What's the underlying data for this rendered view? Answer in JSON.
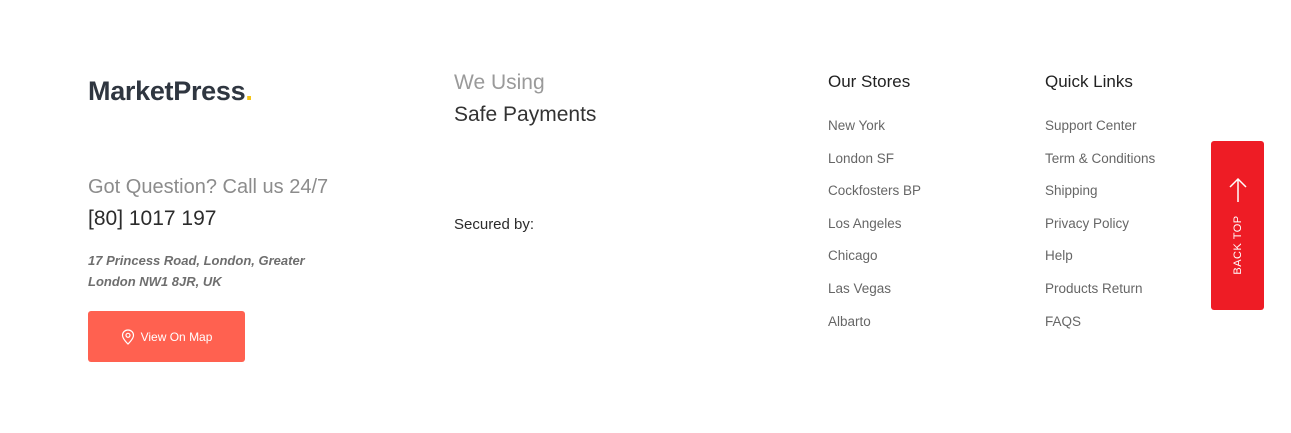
{
  "brand": {
    "name": "MarketPress",
    "dot": ".",
    "accent_color": "#f5c518"
  },
  "contact": {
    "question": "Got Question? Call us 24/7",
    "phone": "[80] 1017 197",
    "address_line1": "17 Princess Road, London, Greater",
    "address_line2": "London NW1 8JR, UK",
    "map_button_label": "View On Map",
    "map_button_icon": "map-pin-icon",
    "map_button_color": "#ff6150"
  },
  "payments": {
    "pre_title": "We Using",
    "title": "Safe Payments",
    "secured_label": "Secured by:"
  },
  "stores": {
    "title": "Our Stores",
    "items": [
      "New York",
      "London SF",
      "Cockfosters BP",
      "Los Angeles",
      "Chicago",
      "Las Vegas",
      "Albarto"
    ]
  },
  "quick_links": {
    "title": "Quick Links",
    "items": [
      "Support Center",
      "Term & Conditions",
      "Shipping",
      "Privacy Policy",
      "Help",
      "Products Return",
      "FAQS"
    ]
  },
  "back_top": {
    "label": "BACK TOP",
    "icon": "arrow-up-icon",
    "color": "#ee1c25"
  }
}
